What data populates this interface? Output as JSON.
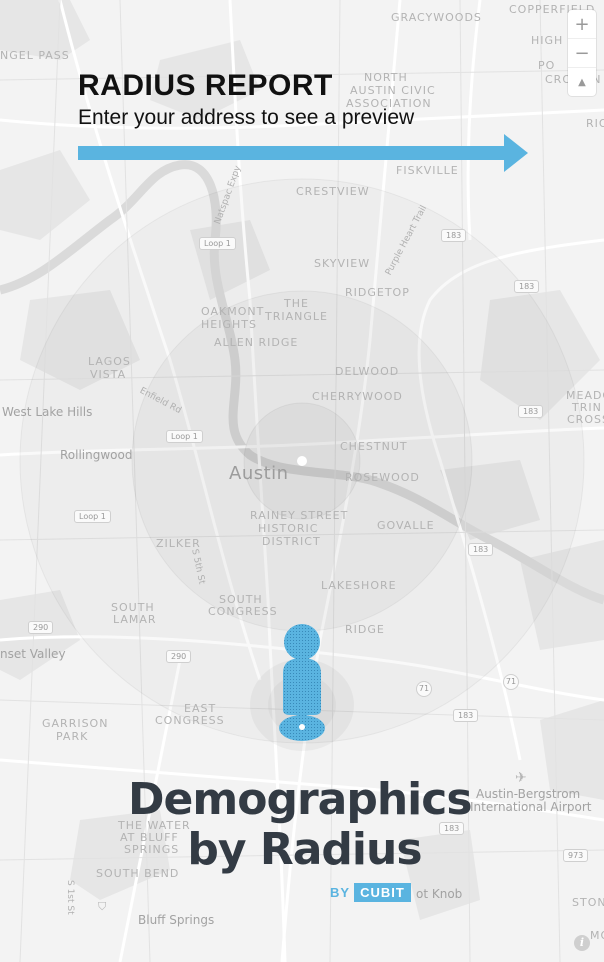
{
  "header": {
    "title": "RADIUS REPORT",
    "subtitle": "Enter your address to see a preview"
  },
  "map_controls": {
    "zoom_in": "+",
    "zoom_out": "−",
    "compass": "▲"
  },
  "map_labels": {
    "gracywoods": "GRACYWOODS",
    "copperfield": "COPPERFIELD",
    "angel_pass": "NGEL PASS",
    "north_austin_civic_1": "NORTH",
    "north_austin_civic_2": "AUSTIN CIVIC",
    "north_austin_civic_3": "ASSOCIATION",
    "high_pointe_1": "HIGH",
    "high_pointe_2": "PO",
    "crossing": "CROSSIN",
    "fiskville": "FISKVILLE",
    "rio": "RIO",
    "crestview": "CRESTVIEW",
    "skyview": "SKYVIEW",
    "ridgetop": "RIDGETOP",
    "oakmont_heights_1": "OAKMONT",
    "oakmont_heights_2": "HEIGHTS",
    "the_triangle_1": "THE",
    "the_triangle_2": "TRIANGLE",
    "allen_ridge": "ALLEN RIDGE",
    "lagos_vista_1": "LAGOS",
    "lagos_vista_2": "VISTA",
    "delwood": "DELWOOD",
    "cherrywood": "CHERRYWOOD",
    "west_lake_hills": "West Lake Hills",
    "enfield_rd": "Enfield Rd",
    "meadow_1": "MEADOW",
    "meadow_2": "TRIN",
    "meadow_3": "CROSS",
    "rollingwood": "Rollingwood",
    "chestnut": "CHESTNUT",
    "austin": "Austin",
    "rosewood": "ROSEWOOD",
    "rainey_1": "RAINEY STREET",
    "rainey_2": "HISTORIC",
    "rainey_3": "DISTRICT",
    "govalle": "GOVALLE",
    "zilker": "ZILKER",
    "s_5th_st": "S 5th St",
    "south_congress_1": "SOUTH",
    "south_congress_2": "CONGRESS",
    "south_lamar_1": "SOUTH",
    "south_lamar_2": "LAMAR",
    "lakeshore": "LAKESHORE",
    "ridge_pl": "RIDGE",
    "sunset_valley": "nset Valley",
    "garrison_park_1": "GARRISON",
    "garrison_park_2": "PARK",
    "east_congress_1": "EAST",
    "east_congress_2": "CONGRESS",
    "the_waters_1": "THE WATER",
    "the_waters_2": "AT BLUFF",
    "the_waters_3": "SPRINGS",
    "south_bend": "SOUTH BEND",
    "s_1st_st": "S 1st St",
    "bluff_springs": "Bluff Springs",
    "airport_1": "Austin-Bergstrom",
    "airport_2": "International Airport",
    "pilot_knob": "ot Knob",
    "stony": "STON",
    "mo": "MO",
    "nat_e_kwy": "Natspac Expy",
    "purple_heart": "Purple Heart Trail",
    "loop1_a": "Loop 1",
    "loop1_b": "Loop 1",
    "loop1_c": "Loop 1",
    "hwy183_a": "183",
    "hwy183_b": "183",
    "hwy183_c": "183",
    "hwy183_d": "183",
    "hwy183_e": "183",
    "hwy183_f": "183",
    "hwy290_a": "290",
    "hwy290_b": "290",
    "hwy71_a": "71",
    "hwy71_b": "71",
    "hwy973": "973"
  },
  "logo": {
    "line1": "Demographics",
    "line2": "by Radius",
    "by": "BY",
    "brand": "CUBIT"
  },
  "colors": {
    "accent": "#5ab4e0",
    "logo_text": "#333b44",
    "map_bg": "#f3f3f3"
  },
  "icons": {
    "arrow": "arrow-right-icon",
    "person": "person-pin-icon",
    "info": "info-icon",
    "airport": "airplane-icon"
  }
}
